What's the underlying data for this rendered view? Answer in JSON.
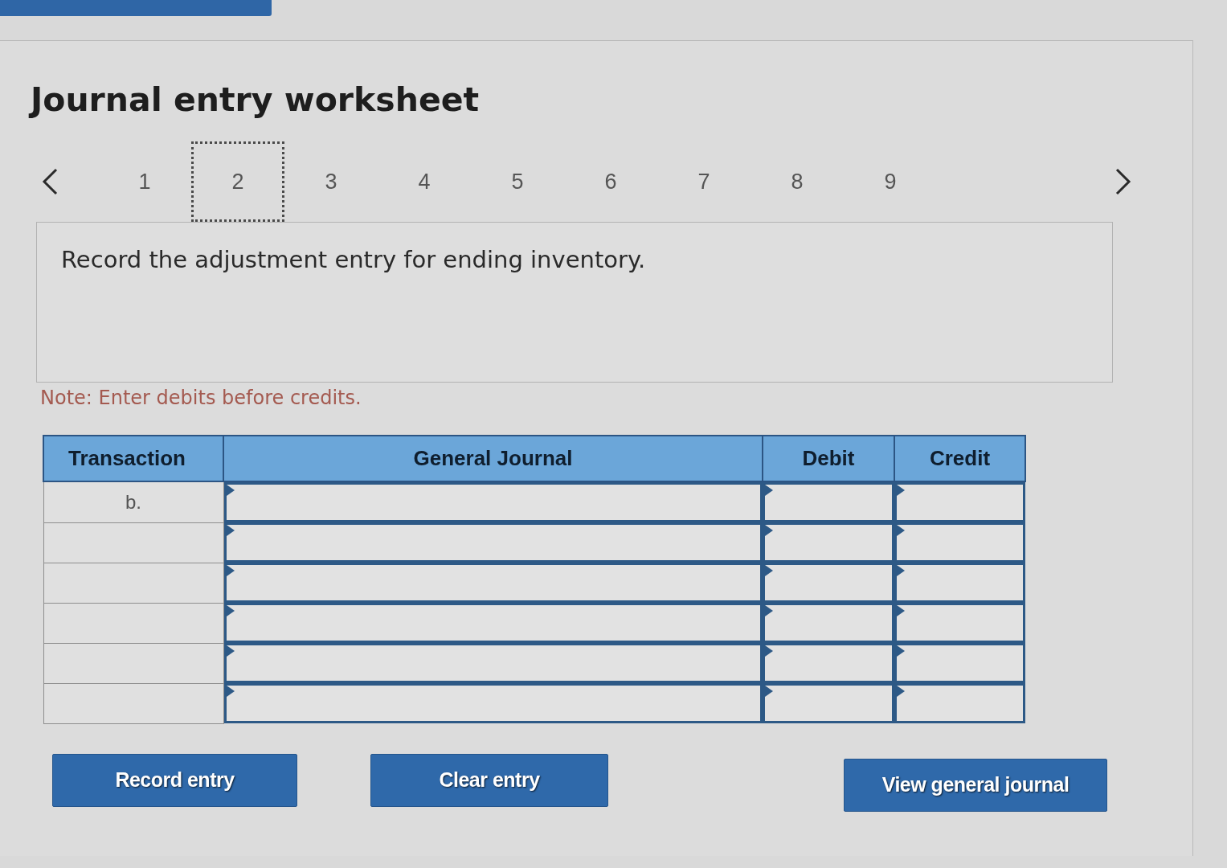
{
  "title": "Journal entry worksheet",
  "pagination": {
    "pages": [
      {
        "label": "1",
        "selected": false
      },
      {
        "label": "2",
        "selected": true
      },
      {
        "label": "3",
        "selected": false
      },
      {
        "label": "4",
        "selected": false
      },
      {
        "label": "5",
        "selected": false
      },
      {
        "label": "6",
        "selected": false
      },
      {
        "label": "7",
        "selected": false
      },
      {
        "label": "8",
        "selected": false
      },
      {
        "label": "9",
        "selected": false
      }
    ]
  },
  "prompt": "Record the adjustment entry for ending inventory.",
  "note": "Note: Enter debits before credits.",
  "table": {
    "columns": [
      "Transaction",
      "General Journal",
      "Debit",
      "Credit"
    ],
    "rows": [
      {
        "transaction": "b."
      },
      {},
      {},
      {},
      {},
      {}
    ]
  },
  "entry_buttons": [
    "Record entry",
    "Clear entry"
  ],
  "journal_button": "View general journal"
}
